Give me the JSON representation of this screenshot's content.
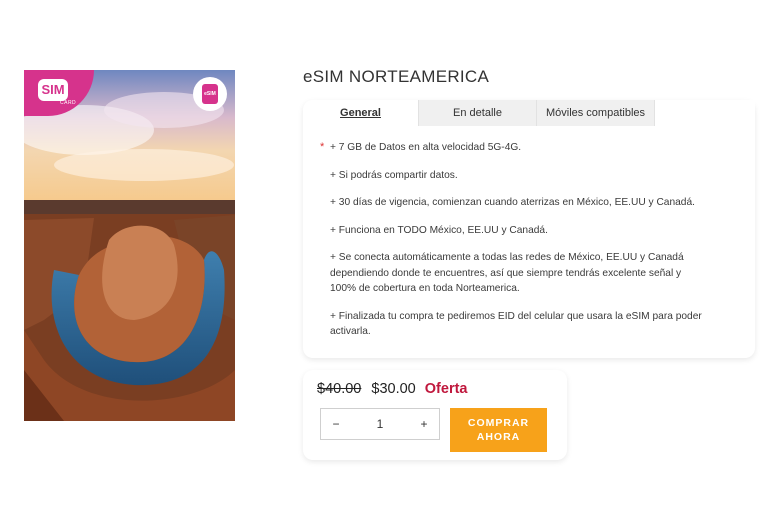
{
  "product": {
    "title": "eSIM NORTEAMERICA",
    "logo_text": "SIM",
    "logo_subtext": "CARD",
    "chip_text": "eSIM"
  },
  "tabs": [
    {
      "label": "General",
      "active": true
    },
    {
      "label": "En detalle",
      "active": false
    },
    {
      "label": "Móviles compatibles",
      "active": false
    }
  ],
  "features": [
    "+ 7 GB de Datos en alta velocidad 5G-4G.",
    "+ Si podrás compartir datos.",
    "+ 30 días de vigencia, comienzan cuando aterrizas en México, EE.UU y Canadá.",
    "+ Funciona en TODO México, EE.UU y Canadá.",
    "+ Se conecta automáticamente a todas las redes de México, EE.UU y Canadá dependiendo donde te encuentres, así que siempre tendrás excelente señal y 100% de cobertura en toda Norteamerica.",
    "+ Finalizada tu compra te pediremos EID del celular que usara la eSIM para poder activarla."
  ],
  "pricing": {
    "old_price": "$40.00",
    "new_price": "$30.00",
    "sale_label": "Oferta"
  },
  "quantity": {
    "minus": "−",
    "value": "1",
    "plus": "+"
  },
  "buy_button": {
    "label": "COMPRAR AHORA"
  },
  "colors": {
    "accent_orange": "#f7a21a",
    "sale_red": "#c0183d",
    "brand_pink": "#d6338c"
  }
}
